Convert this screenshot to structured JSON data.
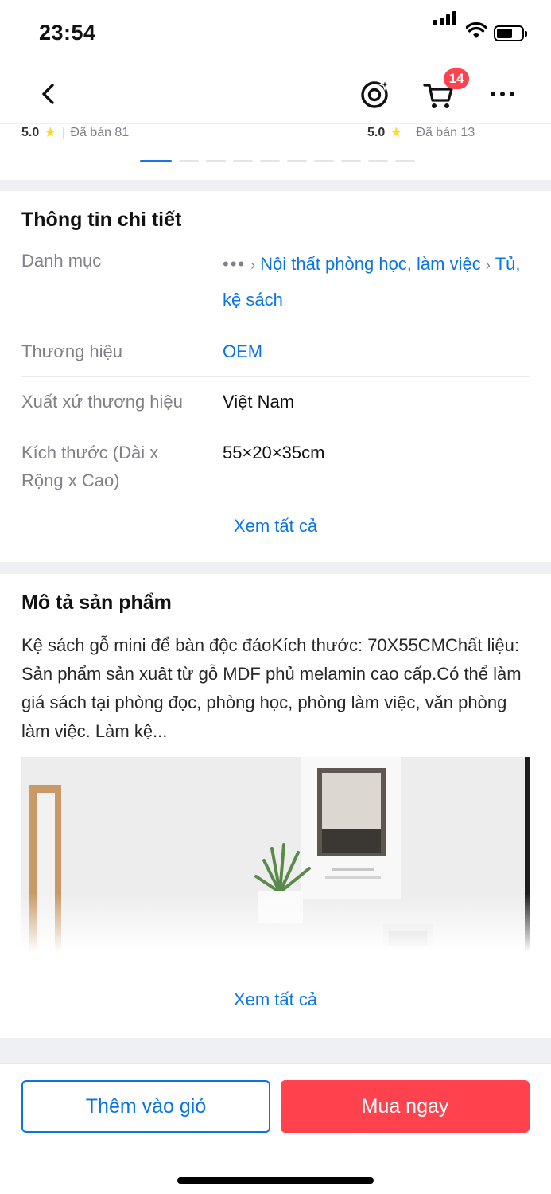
{
  "status_bar": {
    "time": "23:54"
  },
  "nav": {
    "cart_count": "14",
    "icons": [
      "back-arrow-icon",
      "sparkle-icon",
      "cart-icon",
      "more-icon"
    ]
  },
  "related_products": [
    {
      "rating": "5.0",
      "sold": "Đã bán 81"
    },
    {
      "rating": "5.0",
      "sold": "Đã bán 13"
    }
  ],
  "carousel": {
    "pages": 10,
    "active": 1
  },
  "details": {
    "title": "Thông tin chi tiết",
    "rows": [
      {
        "label": "Danh mục",
        "breadcrumb_more": "•••",
        "path_1": "Nội thất phòng học, làm việc",
        "path_2": "Tủ, kệ sách"
      },
      {
        "label": "Thương hiệu",
        "value": "OEM"
      },
      {
        "label": "Xuất xứ thương hiệu",
        "value": "Việt Nam"
      },
      {
        "label": "Kích thước (Dài x Rộng x Cao)",
        "value": "55×20×35cm"
      }
    ],
    "view_all": "Xem tất cả"
  },
  "description": {
    "title": "Mô tả sản phẩm",
    "text": "Kệ sách gỗ mini để bàn độc đáoKích thước: 70X55CMChất liệu: Sản phẩm sản xuât từ gỗ MDF phủ melamin cao cấp.Có thể làm giá sách tại phòng đọc, phòng học, phòng làm việc, văn phòng làm việc. Làm kệ...",
    "view_all": "Xem tất cả"
  },
  "actions": {
    "add_to_cart": "Thêm vào giỏ",
    "buy_now": "Mua ngay"
  },
  "colors": {
    "accent_blue": "#0b74e5",
    "buy_red": "#ff424e",
    "badge_red": "#ff424f",
    "star": "#fdd836"
  }
}
